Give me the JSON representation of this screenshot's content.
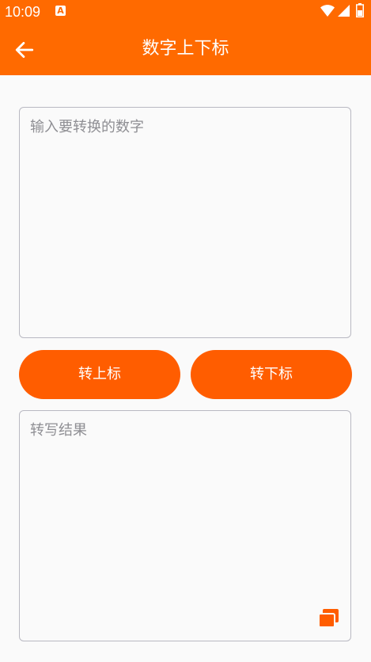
{
  "status_bar": {
    "time": "10:09",
    "notification_icon": "a-notification-icon",
    "wifi_icon": "wifi-icon",
    "signal_icon": "cellular-signal-icon",
    "battery_icon": "battery-icon"
  },
  "header": {
    "title": "数字上下标",
    "back_icon": "arrow-left-icon",
    "background_color": "#ff6a00"
  },
  "input": {
    "value": "",
    "placeholder": "输入要转换的数字"
  },
  "buttons": {
    "superscript_label": "转上标",
    "subscript_label": "转下标",
    "color": "#ff5d00"
  },
  "output": {
    "value": "",
    "placeholder": "转写结果",
    "copy_icon": "copy-icon"
  }
}
